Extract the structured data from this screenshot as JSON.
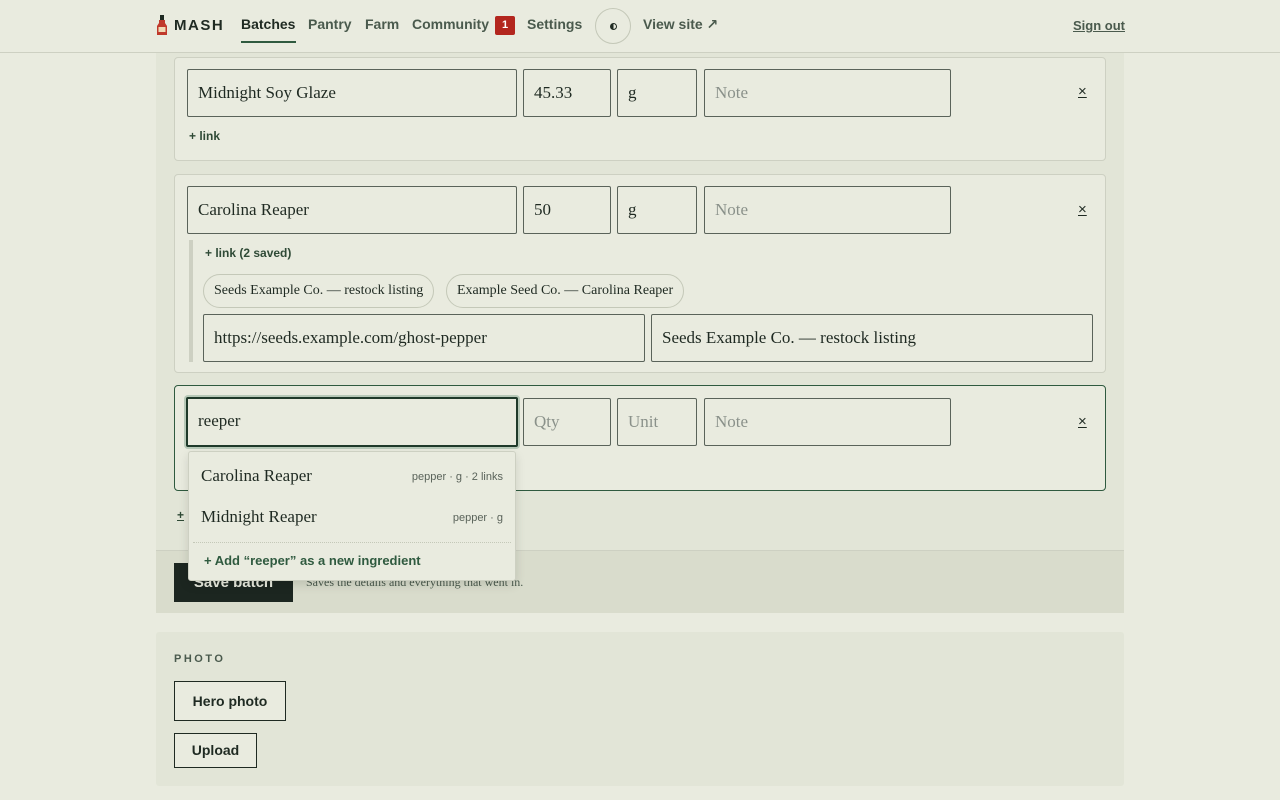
{
  "nav": {
    "brand": "MASH",
    "links": [
      "Batches",
      "Pantry",
      "Farm",
      "Community",
      "Settings"
    ],
    "community_badge": "1",
    "view_site": "View site ↗",
    "sign_out": "Sign out"
  },
  "ingredients": [
    {
      "name": "Midnight Soy Glaze",
      "qty": "45.33",
      "unit": "g",
      "note_placeholder": "Note",
      "link_label": "+ link",
      "remove": "×"
    },
    {
      "name": "Carolina Reaper",
      "qty": "50",
      "unit": "g",
      "note_placeholder": "Note",
      "link_label": "+ link (2 saved)",
      "remove": "×",
      "saved_links": [
        "Seeds Example Co. — restock listing",
        "Example Seed Co. — Carolina Reaper"
      ],
      "link_url": "https://seeds.example.com/ghost-pepper",
      "link_title": "Seeds Example Co. — restock listing"
    },
    {
      "name": "reeper",
      "qty_placeholder": "Qty",
      "unit_placeholder": "Unit",
      "note_placeholder": "Note",
      "remove": "×"
    }
  ],
  "autocomplete": {
    "items": [
      {
        "name": "Carolina Reaper",
        "meta": "pepper · g · 2 links"
      },
      {
        "name": "Midnight Reaper",
        "meta": "pepper · g"
      }
    ],
    "add_new": "+ Add “reeper” as a new ingredient"
  },
  "add_row_label": "+",
  "save": {
    "button": "Save batch",
    "hint": "Saves the details and everything that went in."
  },
  "photo": {
    "label": "PHOTO",
    "hero_button": "Hero photo",
    "upload_button": "Upload"
  },
  "colors": {
    "accent": "#2f5a3f",
    "badge": "#b3261e",
    "background": "#e9ebdf"
  }
}
